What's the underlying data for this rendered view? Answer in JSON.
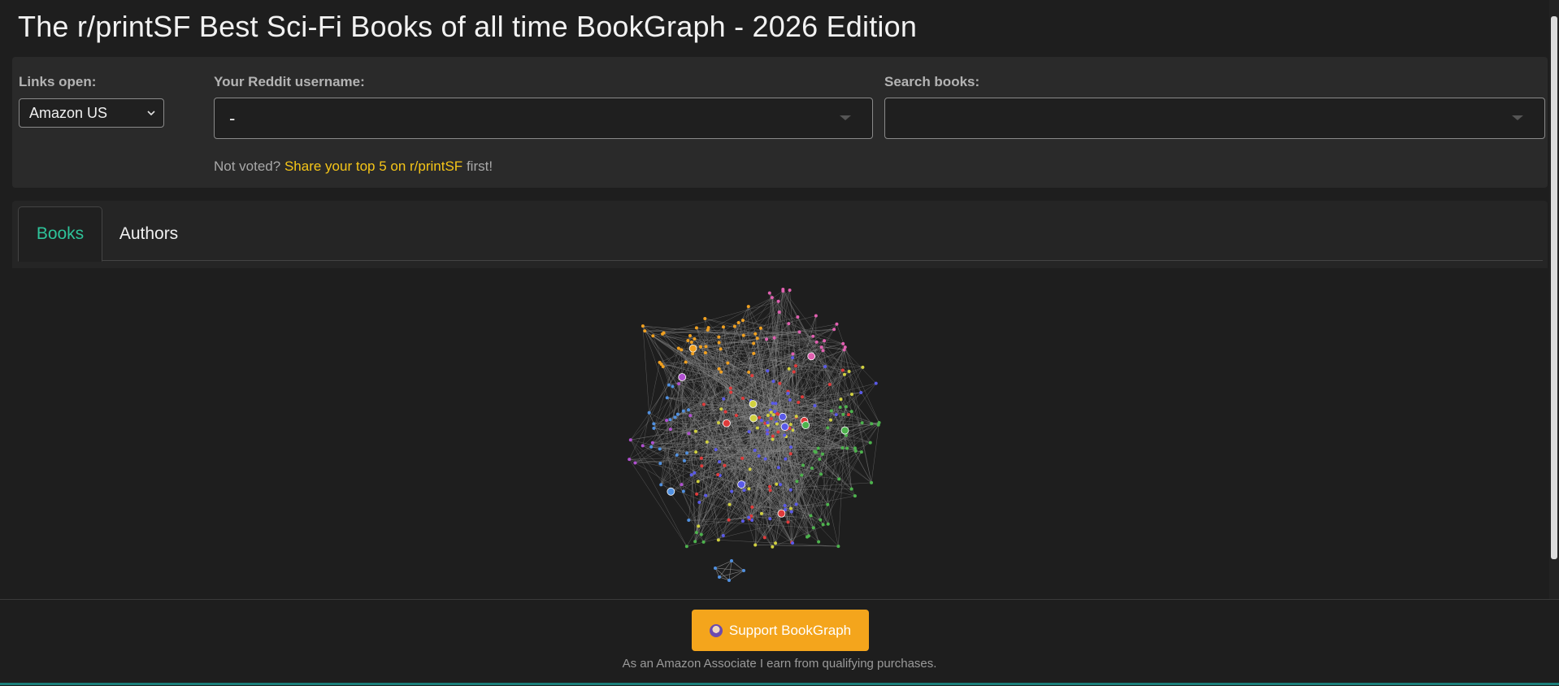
{
  "page": {
    "title": "The r/printSF Best Sci-Fi Books of all time BookGraph - 2026 Edition"
  },
  "controls": {
    "links_label": "Links open:",
    "links_value": "Amazon US",
    "username_label": "Your Reddit username:",
    "username_value": "-",
    "search_label": "Search books:",
    "search_value": "",
    "vote_prefix": "Not voted?",
    "vote_link": "Share your top 5 on r/printSF",
    "vote_suffix": "first!"
  },
  "tabs": [
    {
      "label": "Books",
      "active": true
    },
    {
      "label": "Authors",
      "active": false
    }
  ],
  "graph": {
    "description_icon": "network-graph",
    "node_colors": [
      "#e03b3b",
      "#5a5ae8",
      "#4db34d",
      "#f0a020",
      "#e060b0",
      "#5090e0",
      "#b050d0",
      "#d0d040"
    ],
    "edge_color": "#8a8a8a"
  },
  "footer": {
    "support_label": "Support BookGraph",
    "support_icon": "coffee-icon",
    "assoc_text": "As an Amazon Associate I earn from qualifying purchases.",
    "accent_color": "#f4a51c"
  }
}
